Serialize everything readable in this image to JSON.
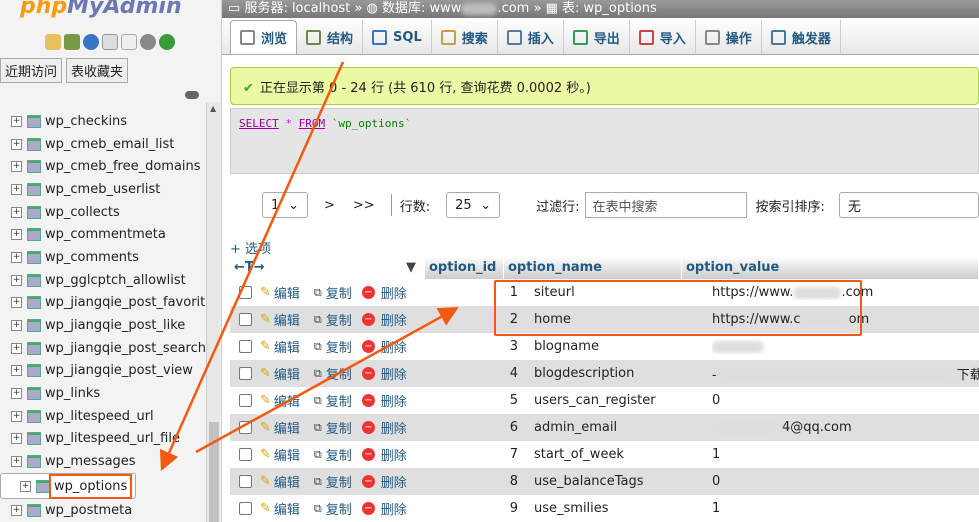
{
  "app": {
    "logo_php": "php",
    "logo_my": "MyAdmin",
    "recent_tab": "近期访问",
    "favorites_tab": "表收藏夹"
  },
  "tree": [
    {
      "name": "wp_checkins"
    },
    {
      "name": "wp_cmeb_email_list"
    },
    {
      "name": "wp_cmeb_free_domains"
    },
    {
      "name": "wp_cmeb_userlist"
    },
    {
      "name": "wp_collects"
    },
    {
      "name": "wp_commentmeta"
    },
    {
      "name": "wp_comments"
    },
    {
      "name": "wp_gglcptch_allowlist"
    },
    {
      "name": "wp_jiangqie_post_favorit"
    },
    {
      "name": "wp_jiangqie_post_like"
    },
    {
      "name": "wp_jiangqie_post_search"
    },
    {
      "name": "wp_jiangqie_post_view"
    },
    {
      "name": "wp_links"
    },
    {
      "name": "wp_litespeed_url"
    },
    {
      "name": "wp_litespeed_url_file"
    },
    {
      "name": "wp_messages"
    },
    {
      "name": "wp_options",
      "selected": true
    },
    {
      "name": "wp_postmeta"
    }
  ],
  "breadcrumb": {
    "server": "服务器: localhost",
    "db": "数据库: www",
    "db_suffix": ".com",
    "table": "表: wp_options"
  },
  "tabs": [
    {
      "label": "浏览",
      "active": true,
      "icon": "browse-icon"
    },
    {
      "label": "结构",
      "icon": "structure-icon"
    },
    {
      "label": "SQL",
      "icon": "sql-icon"
    },
    {
      "label": "搜索",
      "icon": "search-icon"
    },
    {
      "label": "插入",
      "icon": "insert-icon"
    },
    {
      "label": "导出",
      "icon": "export-icon"
    },
    {
      "label": "导入",
      "icon": "import-icon"
    },
    {
      "label": "操作",
      "icon": "wrench-icon"
    },
    {
      "label": "触发器",
      "icon": "trigger-icon"
    }
  ],
  "message": "正在显示第 0 - 24 行 (共 610 行, 查询花费 0.0002 秒。)",
  "sql": {
    "select": "SELECT",
    "star": "*",
    "from": "FROM",
    "table": "`wp_options`"
  },
  "nav": {
    "page": "1",
    "next": ">",
    "last": ">>",
    "rows_label": "行数:",
    "rows_value": "25",
    "filter_label": "过滤行:",
    "filter_placeholder": "在表中搜索",
    "sort_label": "按索引排序:",
    "sort_value": "无"
  },
  "options_link": "+ 选项",
  "columns": {
    "id": "option_id",
    "name": "option_name",
    "value": "option_value"
  },
  "actions": {
    "edit": "编辑",
    "copy": "复制",
    "delete": "删除"
  },
  "rows": [
    {
      "id": "1",
      "name": "siteurl",
      "value": "https://www.",
      "value_suffix": ".com"
    },
    {
      "id": "2",
      "name": "home",
      "value": "https://www.c",
      "value_suffix": "om"
    },
    {
      "id": "3",
      "name": "blogname",
      "value": "",
      "value_suffix": ""
    },
    {
      "id": "4",
      "name": "blogdescription",
      "value": "-",
      "value_suffix": "下载,网"
    },
    {
      "id": "5",
      "name": "users_can_register",
      "value": "0",
      "value_suffix": ""
    },
    {
      "id": "6",
      "name": "admin_email",
      "value": "",
      "value_suffix": "4@qq.com"
    },
    {
      "id": "7",
      "name": "start_of_week",
      "value": "1",
      "value_suffix": ""
    },
    {
      "id": "8",
      "name": "use_balanceTags",
      "value": "0",
      "value_suffix": ""
    },
    {
      "id": "9",
      "name": "use_smilies",
      "value": "1",
      "value_suffix": ""
    }
  ],
  "colors": {
    "accent": "#235a81",
    "highlight": "#f25a0f",
    "success_bg": "#ebf8a4"
  }
}
